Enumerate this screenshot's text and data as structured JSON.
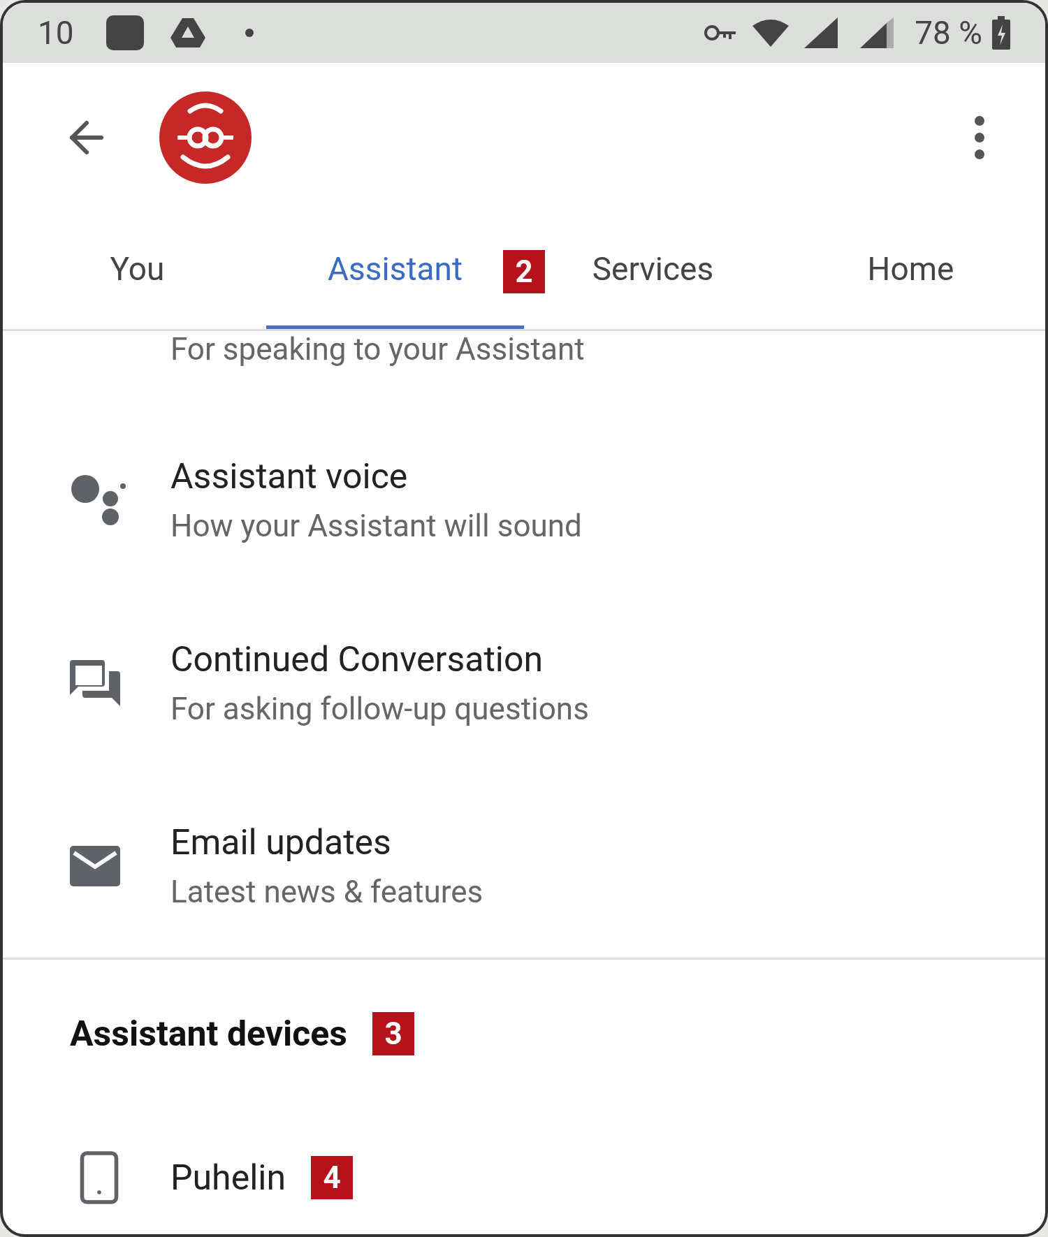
{
  "status_bar": {
    "time": "10",
    "battery": "78 %"
  },
  "tabs": [
    {
      "label": "You",
      "selected": false
    },
    {
      "label": "Assistant",
      "selected": true,
      "badge": "2"
    },
    {
      "label": "Services",
      "selected": false
    },
    {
      "label": "Home",
      "selected": false
    }
  ],
  "partial_item": {
    "subtitle": "For speaking to your Assistant"
  },
  "settings": [
    {
      "kind": "voice",
      "title": "Assistant voice",
      "subtitle": "How your Assistant will sound"
    },
    {
      "kind": "chat",
      "title": "Continued Conversation",
      "subtitle": "For asking follow-up questions"
    },
    {
      "kind": "mail",
      "title": "Email updates",
      "subtitle": "Latest news & features"
    }
  ],
  "section": {
    "heading": "Assistant devices",
    "badge": "3"
  },
  "devices": [
    {
      "kind": "phone",
      "name": "Puhelin",
      "badge": "4"
    }
  ]
}
